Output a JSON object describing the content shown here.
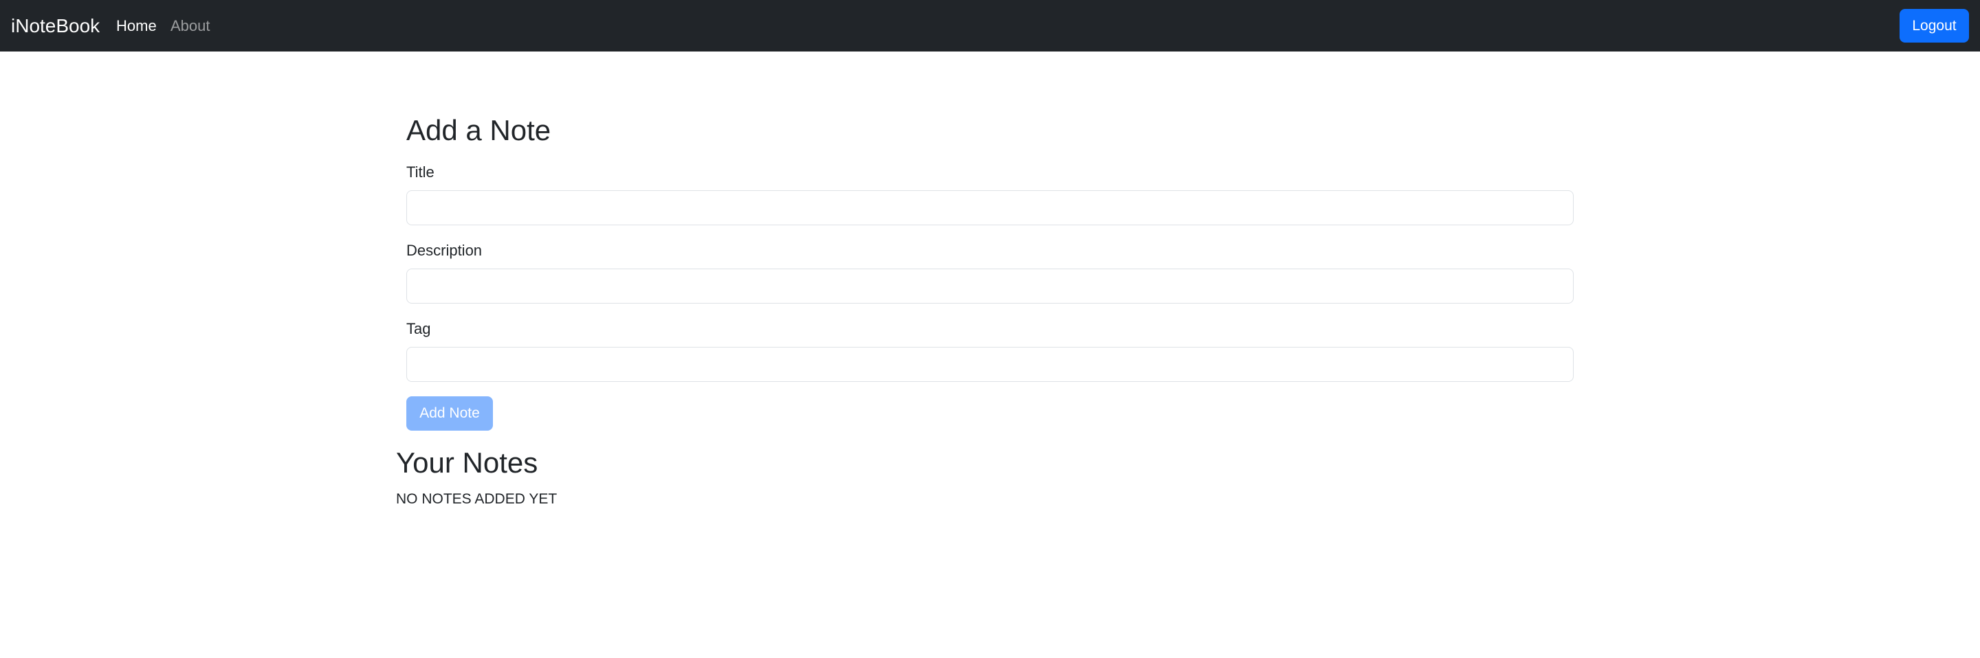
{
  "navbar": {
    "brand": "iNoteBook",
    "links": [
      {
        "label": "Home",
        "active": true
      },
      {
        "label": "About",
        "active": false
      }
    ],
    "logout_label": "Logout"
  },
  "form": {
    "heading": "Add a Note",
    "fields": {
      "title": {
        "label": "Title",
        "value": "",
        "placeholder": ""
      },
      "description": {
        "label": "Description",
        "value": "",
        "placeholder": ""
      },
      "tag": {
        "label": "Tag",
        "value": "",
        "placeholder": ""
      }
    },
    "submit_label": "Add Note",
    "submit_disabled": true
  },
  "notes": {
    "heading": "Your Notes",
    "empty_message": "NO NOTES ADDED YET"
  },
  "colors": {
    "navbar_bg": "#212529",
    "primary": "#0d6efd",
    "text": "#212529",
    "input_border": "#dee2e6"
  }
}
